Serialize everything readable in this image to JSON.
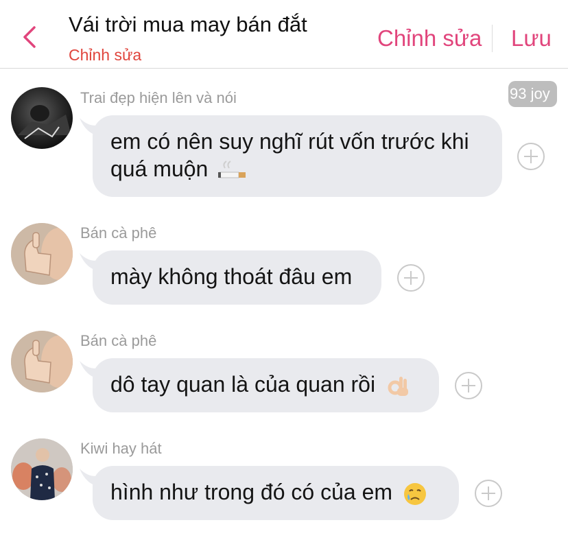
{
  "header": {
    "title": "Vái trời mua may bán đắt",
    "subtitle": "Chỉnh sửa",
    "edit_label": "Chỉnh sửa",
    "save_label": "Lưu",
    "accent_color": "#e1457c",
    "subtitle_color": "#e0453d"
  },
  "messages": [
    {
      "sender": "Trai đẹp hiện lên và nói",
      "text_line1": "em có nên suy nghĩ rút vốn trước khi",
      "text_line2": "quá muộn",
      "emoji": "cigarette-emoji",
      "badge": "93 joy"
    },
    {
      "sender": "Bán cà phê",
      "text": "mày không thoát đâu em"
    },
    {
      "sender": "Bán cà phê",
      "text": "dô tay quan là của quan rồi",
      "emoji": "ok-hand-emoji"
    },
    {
      "sender": "Kiwi hay hát",
      "text": "hình như trong đó có của em",
      "emoji": "crying-face-emoji"
    }
  ],
  "colors": {
    "bubble": "#e9eaee",
    "sender_text": "#9a9a9a",
    "badge_bg": "#bdbdbd"
  }
}
